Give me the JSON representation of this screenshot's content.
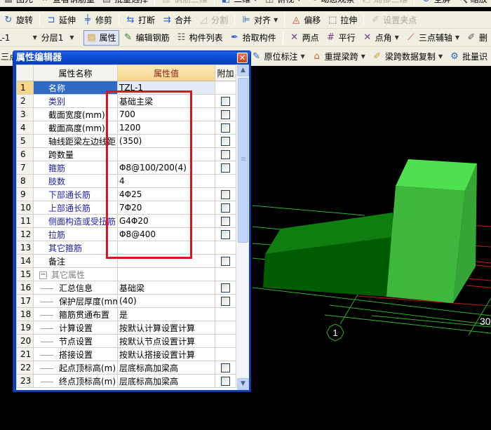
{
  "toolbar0": {
    "items": [
      {
        "icon": "element-icon",
        "label": "图元"
      },
      {
        "icon": "glasses-icon",
        "label": "查看钢筋量"
      },
      {
        "icon": "batch-select-icon",
        "label": "批量选择"
      },
      {
        "icon": "rebar-3d-icon",
        "label": "钢筋三维",
        "disabled": true
      },
      {
        "icon": "cube-icon",
        "label": "二维"
      },
      {
        "icon": "cube-view-icon",
        "label": "俯视"
      },
      {
        "icon": "dynamic-view-icon",
        "label": "动态观察"
      },
      {
        "icon": "local-3d-icon",
        "label": "局部三维",
        "disabled": true
      },
      {
        "icon": "fullscreen-icon",
        "label": "全屏"
      },
      {
        "icon": "zoom-icon",
        "label": "缩放"
      }
    ]
  },
  "toolbar1": {
    "items": [
      {
        "icon": "rotate-icon",
        "label": "旋转"
      },
      {
        "icon": "extend-icon",
        "label": "延伸"
      },
      {
        "icon": "trim-icon",
        "label": "修剪"
      },
      {
        "icon": "break-icon",
        "label": "打断"
      },
      {
        "icon": "merge-icon",
        "label": "合并"
      },
      {
        "icon": "split-icon",
        "label": "分割",
        "disabled": true
      },
      {
        "icon": "align-icon",
        "label": "对齐"
      },
      {
        "icon": "offset-icon",
        "label": "偏移"
      },
      {
        "icon": "stretch-icon",
        "label": "拉伸"
      },
      {
        "icon": "set-grip-icon",
        "label": "设置夹点",
        "disabled": true
      }
    ]
  },
  "toolbar2": {
    "component_select": "L-1",
    "layer_select": "分层1",
    "items": [
      {
        "icon": "properties-icon",
        "label": "属性",
        "active": true
      },
      {
        "icon": "edit-rebar-icon",
        "label": "编辑钢筋"
      },
      {
        "icon": "component-list-icon",
        "label": "构件列表"
      },
      {
        "icon": "pick-component-icon",
        "label": "拾取构件"
      },
      {
        "icon": "two-point-axis-icon",
        "label": "两点"
      },
      {
        "icon": "parallel-axis-icon",
        "label": "平行"
      },
      {
        "icon": "point-angle-icon",
        "label": "点角"
      },
      {
        "icon": "three-point-axis-icon",
        "label": "三点辅轴"
      },
      {
        "icon": "delete-axis-icon",
        "label": "删"
      }
    ]
  },
  "toolbar3": {
    "left_label": "三点",
    "items": [
      {
        "icon": "in-situ-annotation-icon",
        "label": "原位标注"
      },
      {
        "icon": "re-extract-span-icon",
        "label": "重提梁跨"
      },
      {
        "icon": "span-data-copy-icon",
        "label": "梁跨数据复制"
      },
      {
        "icon": "batch-icon",
        "label": "批量识"
      }
    ]
  },
  "property_editor": {
    "title": "属性编辑器",
    "headers": {
      "index": "",
      "name": "属性名称",
      "value": "属性值",
      "extra": "附加"
    },
    "rows": [
      {
        "n": "1",
        "name": "名称",
        "value": "TZL-1",
        "style": "normal",
        "selected": true,
        "checkbox": false
      },
      {
        "n": "2",
        "name": "类别",
        "value": "基础主梁",
        "style": "blue",
        "checkbox": true
      },
      {
        "n": "3",
        "name": "截面宽度(mm)",
        "value": "700",
        "style": "normal",
        "checkbox": true
      },
      {
        "n": "4",
        "name": "截面高度(mm)",
        "value": "1200",
        "style": "normal",
        "checkbox": true
      },
      {
        "n": "5",
        "name": "轴线距梁左边线距",
        "value": "(350)",
        "style": "normal",
        "checkbox": true
      },
      {
        "n": "6",
        "name": "跨数量",
        "value": "",
        "style": "normal",
        "checkbox": true
      },
      {
        "n": "7",
        "name": "箍筋",
        "value": "Φ8@100/200(4)",
        "style": "blue",
        "checkbox": true
      },
      {
        "n": "8",
        "name": "肢数",
        "value": "4",
        "style": "blue",
        "checkbox": false
      },
      {
        "n": "9",
        "name": "下部通长筋",
        "value": "4Φ25",
        "style": "blue",
        "checkbox": true
      },
      {
        "n": "10",
        "name": "上部通长筋",
        "value": "7Φ20",
        "style": "blue",
        "checkbox": true
      },
      {
        "n": "11",
        "name": "侧面构造或受扭筋",
        "value": "G4Φ20",
        "style": "blue",
        "checkbox": true
      },
      {
        "n": "12",
        "name": "拉筋",
        "value": "Φ8@400",
        "style": "blue",
        "checkbox": true
      },
      {
        "n": "13",
        "name": "其它箍筋",
        "value": "",
        "style": "blue",
        "checkbox": false
      },
      {
        "n": "14",
        "name": "备注",
        "value": "",
        "style": "normal",
        "checkbox": true
      },
      {
        "n": "15",
        "name": "其它属性",
        "value": "",
        "style": "group",
        "checkbox": false,
        "expander": "−"
      },
      {
        "n": "16",
        "name": "汇总信息",
        "value": "基础梁",
        "style": "child",
        "checkbox": true
      },
      {
        "n": "17",
        "name": "保护层厚度(mm)",
        "value": "(40)",
        "style": "child",
        "checkbox": true
      },
      {
        "n": "18",
        "name": "箍筋贯通布置",
        "value": "是",
        "style": "child",
        "checkbox": false
      },
      {
        "n": "19",
        "name": "计算设置",
        "value": "按默认计算设置计算",
        "style": "child",
        "checkbox": false
      },
      {
        "n": "20",
        "name": "节点设置",
        "value": "按默认节点设置计算",
        "style": "child",
        "checkbox": false
      },
      {
        "n": "21",
        "name": "搭接设置",
        "value": "按默认搭接设置计算",
        "style": "child",
        "checkbox": false
      },
      {
        "n": "22",
        "name": "起点顶标高(m)",
        "value": "层底标高加梁高",
        "style": "child",
        "checkbox": true
      },
      {
        "n": "23",
        "name": "终点顶标高(m)",
        "value": "层底标高加梁高",
        "style": "child",
        "checkbox": true
      }
    ],
    "scroll_position": 0
  },
  "viewport": {
    "axis_label_1": "1",
    "axis_label_2": "30",
    "colors": {
      "beam_top": "#0f7d0f",
      "beam_front": "#005c00",
      "column_top": "#4fe04f",
      "column_front": "#3db83d",
      "column_side": "#35a535",
      "grid_green": "#2bb02b",
      "grid_red": "#d01818"
    }
  },
  "annotation": {
    "highlight_color": "#e0121e"
  }
}
